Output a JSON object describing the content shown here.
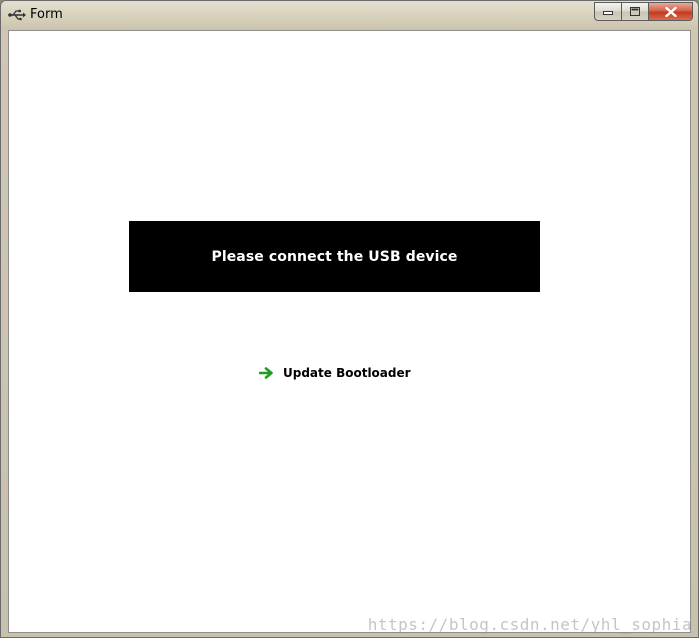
{
  "window": {
    "title": "Form",
    "icons": {
      "app": "usb-icon",
      "minimize": "minimize-icon",
      "maximize": "maximize-icon",
      "close": "close-icon"
    }
  },
  "main": {
    "status_message": "Please connect the USB device",
    "update_link": {
      "label": "Update Bootloader",
      "icon": "arrow-right-icon",
      "icon_color": "#1e9e1e"
    }
  },
  "watermark": "https://blog.csdn.net/yhl_sophia",
  "colors": {
    "banner_bg": "#000000",
    "banner_text": "#ffffff",
    "client_bg": "#ffffff"
  }
}
